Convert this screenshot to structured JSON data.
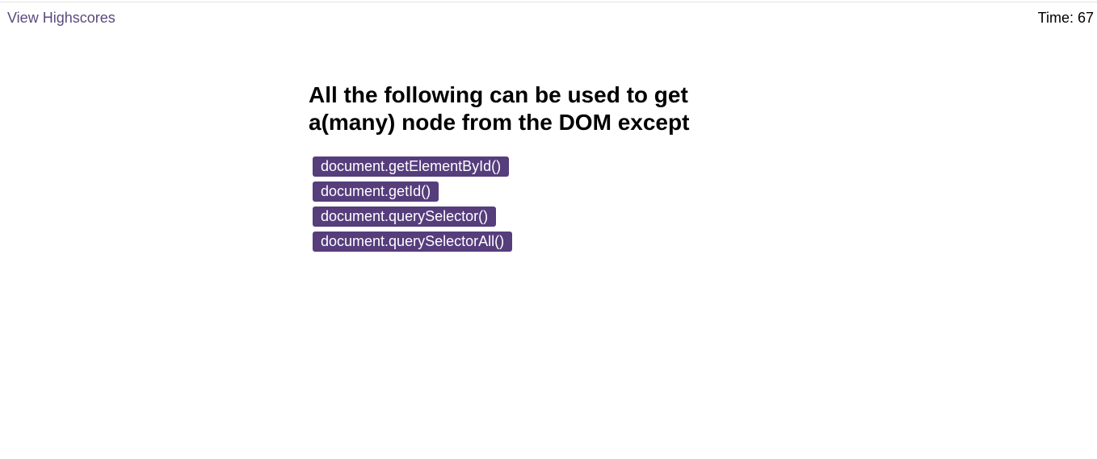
{
  "header": {
    "highscores_link": "View Highscores",
    "timer_label": "Time:",
    "timer_value": "67"
  },
  "quiz": {
    "question": "All the following can be used to get a(many) node from the DOM except",
    "choices": [
      "document.getElementById()",
      "document.getId()",
      "document.querySelector()",
      "document.querySelectorAll()"
    ]
  },
  "colors": {
    "accent": "#563d7c",
    "link": "#5b4a7e"
  }
}
